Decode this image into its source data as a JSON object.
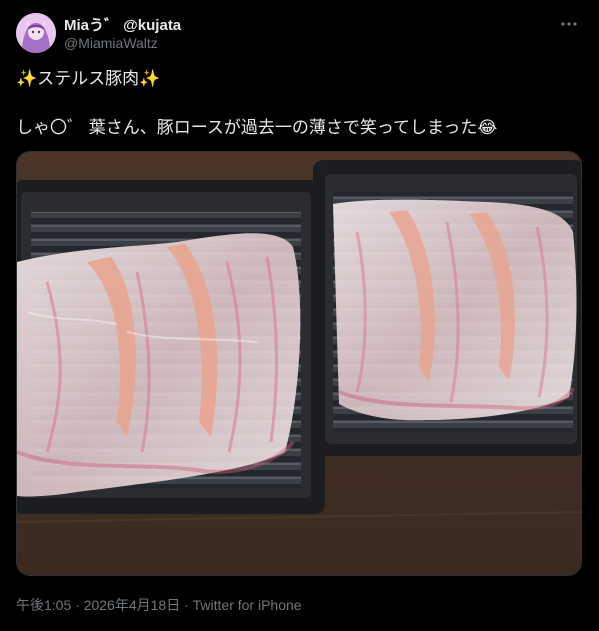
{
  "author": {
    "display_name": "Miaう゛ @kujata",
    "handle": "@MiamiaWaltz"
  },
  "icons": {
    "more": "more-horizontal-icon",
    "avatar": "avatar"
  },
  "tweet": {
    "line1": "✨ステルス豚肉✨",
    "line2": "しゃ〇゛ 葉さん、豚ロースが過去一の薄さで笑ってしまった😂"
  },
  "meta": {
    "timestamp": "午後1:05 · 2026年4月18日 · Twitter for iPhone"
  },
  "colors": {
    "background": "#000000",
    "text": "#e7e9ea",
    "secondary": "#71767b",
    "border": "#2f3336"
  }
}
